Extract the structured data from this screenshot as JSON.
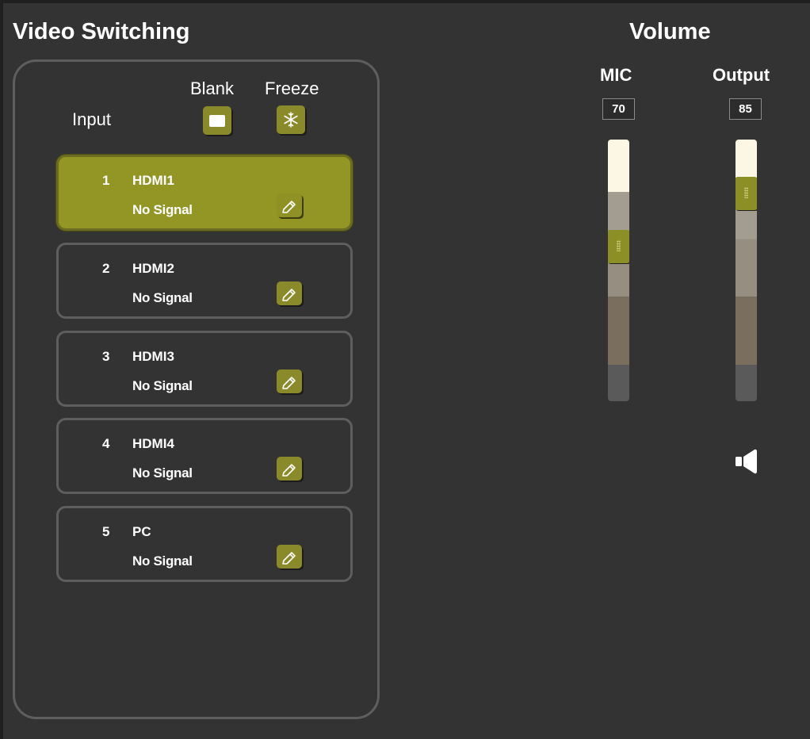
{
  "video_switching": {
    "title": "Video Switching",
    "input_label": "Input",
    "blank_label": "Blank",
    "freeze_label": "Freeze",
    "inputs": [
      {
        "number": "1",
        "name": "HDMI1",
        "status": "No Signal",
        "selected": true
      },
      {
        "number": "2",
        "name": "HDMI2",
        "status": "No Signal",
        "selected": false
      },
      {
        "number": "3",
        "name": "HDMI3",
        "status": "No Signal",
        "selected": false
      },
      {
        "number": "4",
        "name": "HDMI4",
        "status": "No Signal",
        "selected": false
      },
      {
        "number": "5",
        "name": "PC",
        "status": "No Signal",
        "selected": false
      }
    ]
  },
  "volume": {
    "title": "Volume",
    "mic": {
      "label": "MIC",
      "value": "70",
      "level": 0.7
    },
    "output": {
      "label": "Output",
      "value": "85",
      "level": 0.85
    },
    "speaker_icon": "speaker-icon"
  },
  "colors": {
    "background": "#333333",
    "accent": "#939525",
    "button": "#8a8a2a",
    "border": "#5e5e5e"
  }
}
